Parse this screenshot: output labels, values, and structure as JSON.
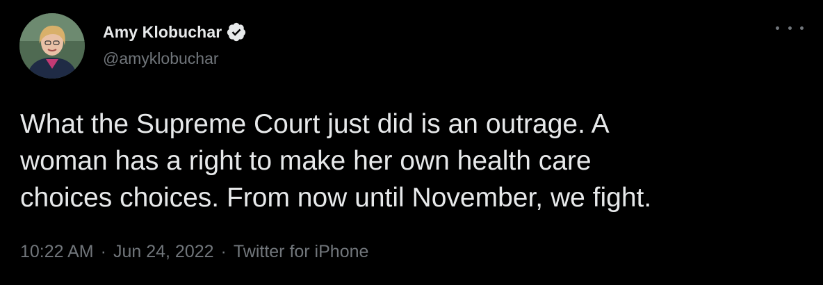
{
  "author": {
    "display_name": "Amy Klobuchar",
    "handle": "@amyklobuchar",
    "verified": true
  },
  "tweet": {
    "text": "What the Supreme Court just did is an outrage. A\nwoman has a right to make her own health care\nchoices choices. From now until November, we fight."
  },
  "meta": {
    "time": "10:22 AM",
    "date": "Jun 24, 2022",
    "source": "Twitter for iPhone",
    "separator": "·"
  },
  "icons": {
    "verified": "verified-badge-icon",
    "more": "more-options-icon"
  },
  "colors": {
    "background": "#000000",
    "primary_text": "#e7e9ea",
    "secondary_text": "#71767b",
    "verified_badge": "#e7e9ea"
  }
}
